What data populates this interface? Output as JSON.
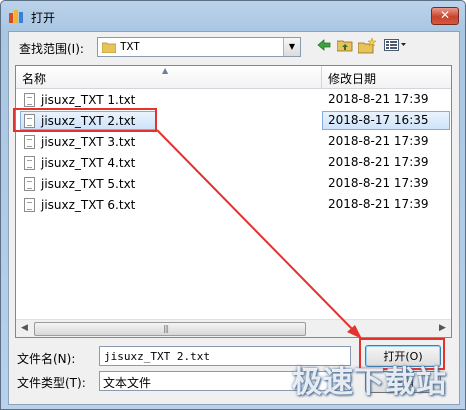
{
  "window": {
    "title": "打开",
    "close_label": "✕"
  },
  "lookin": {
    "label": "查找范围(I):",
    "value": "TXT"
  },
  "toolbar": {
    "back_icon": "back-arrow-icon",
    "up_icon": "up-folder-icon",
    "new_folder_icon": "new-folder-icon",
    "view_menu_icon": "view-menu-icon"
  },
  "list": {
    "columns": {
      "name": "名称",
      "date": "修改日期"
    },
    "files": [
      {
        "name": "jisuxz_TXT 1.txt",
        "date": "2018-8-21 17:39",
        "selected": false
      },
      {
        "name": "jisuxz_TXT 2.txt",
        "date": "2018-8-17 16:35",
        "selected": true
      },
      {
        "name": "jisuxz_TXT 3.txt",
        "date": "2018-8-21 17:39",
        "selected": false
      },
      {
        "name": "jisuxz_TXT 4.txt",
        "date": "2018-8-21 17:39",
        "selected": false
      },
      {
        "name": "jisuxz_TXT 5.txt",
        "date": "2018-8-21 17:39",
        "selected": false
      },
      {
        "name": "jisuxz_TXT 6.txt",
        "date": "2018-8-21 17:39",
        "selected": false
      }
    ]
  },
  "filename": {
    "label": "文件名(N):",
    "value": "jisuxz_TXT 2.txt"
  },
  "filetype": {
    "label": "文件类型(T):",
    "value": "文本文件"
  },
  "buttons": {
    "open": "打开(O)",
    "cancel": "取消"
  },
  "watermark": "极速下载站",
  "colors": {
    "highlight": "#e2332f",
    "selection": "#cfe3fb"
  }
}
